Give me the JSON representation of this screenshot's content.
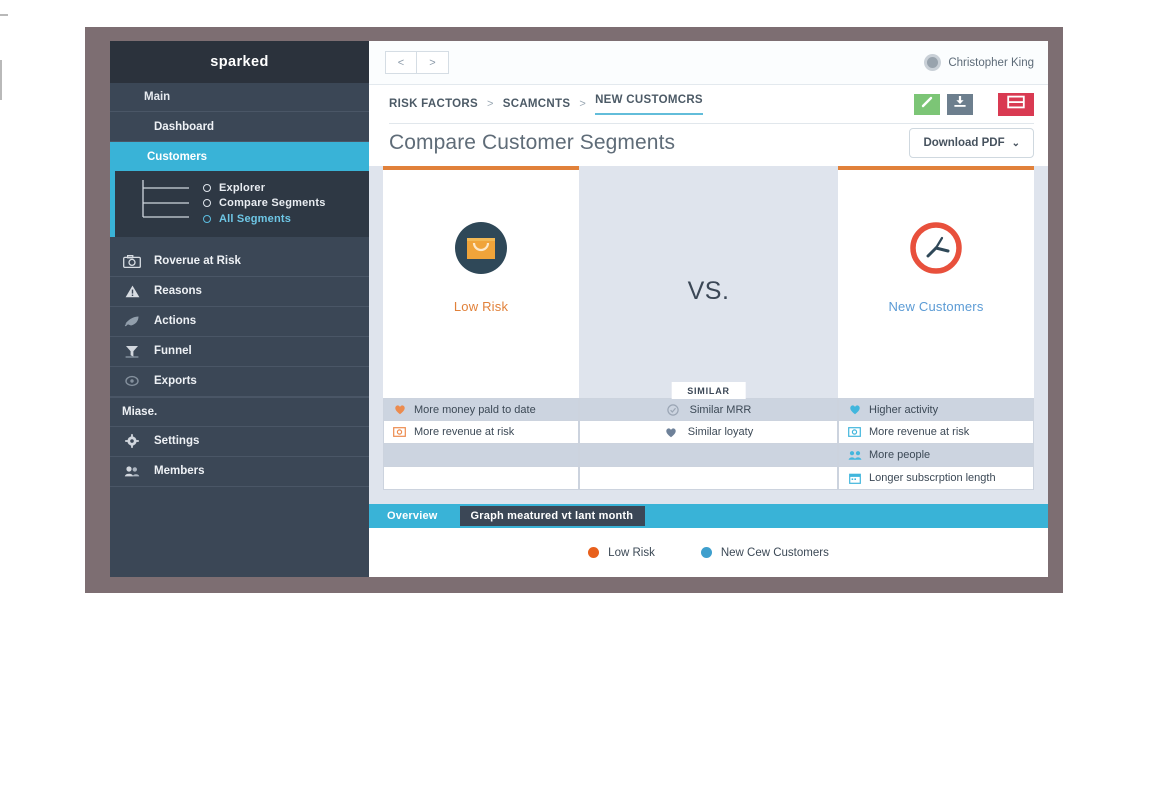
{
  "sidebar": {
    "brand": "sparked",
    "section_main": "Main",
    "items": [
      {
        "label": "Dashboard",
        "icon": "none"
      },
      {
        "label": "Customers",
        "icon": "none"
      }
    ],
    "submenu": [
      {
        "label": "Explorer",
        "selected": false
      },
      {
        "label": "Compare Segments",
        "selected": false
      },
      {
        "label": "All Segments",
        "selected": true
      }
    ],
    "tools": [
      {
        "label": "Roverue at Risk",
        "icon": "camera-icon"
      },
      {
        "label": "Reasons",
        "icon": "warning-triangle-icon"
      },
      {
        "label": "Actions",
        "icon": "rocket-icon"
      },
      {
        "label": "Funnel",
        "icon": "funnel-icon"
      },
      {
        "label": "Exports",
        "icon": "export-icon"
      }
    ],
    "section_misc": "Miase.",
    "bottom": [
      {
        "label": "Settings",
        "icon": "gear-icon"
      },
      {
        "label": "Members",
        "icon": "members-icon"
      }
    ]
  },
  "topbar": {
    "back_label": "<",
    "forward_label": ">",
    "user_name": "Christopher King"
  },
  "breadcrumb": {
    "items": [
      "RISK FACTORS",
      "SCAMCNTS",
      "NEW  CUSTOMCRS"
    ],
    "separator": ">"
  },
  "actions": [
    {
      "name": "edit-button",
      "icon": "pencil-icon",
      "color": "#7cc576"
    },
    {
      "name": "download-button",
      "icon": "download-icon",
      "color": "#6d7f8e"
    },
    {
      "name": "layout-button",
      "icon": "layout-icon",
      "color": "#d93a52"
    }
  ],
  "page": {
    "title": "Compare Customer Segments",
    "download_label": "Download PDF",
    "download_chevron": "⌄"
  },
  "compare": {
    "left": {
      "label": "Low Risk",
      "icon": "shopping-bag-icon",
      "accent": "#e1813a"
    },
    "right": {
      "label": "New Customers",
      "icon": "clock-prohibited-icon",
      "accent": "#5b9bd5"
    },
    "vs_label": "VS.",
    "similar_label": "SIMILAR",
    "left_features": [
      {
        "label": "More money pald to date",
        "icon": "heart-icon"
      },
      {
        "label": "More revenue at risk",
        "icon": "money-icon"
      }
    ],
    "mid_features": [
      {
        "label": "Similar MRR",
        "icon": "circle-check-icon"
      },
      {
        "label": "Similar loyaty",
        "icon": "heart-icon"
      }
    ],
    "right_features": [
      {
        "label": "Higher activity",
        "icon": "heart-icon"
      },
      {
        "label": "More revenue at risk",
        "icon": "money-icon"
      },
      {
        "label": "More  people",
        "icon": "people-icon"
      },
      {
        "label": "Longer subscrption length",
        "icon": "calendar-icon"
      }
    ]
  },
  "bottom": {
    "tab_overview": "Overview",
    "tab_graph": "Graph meatured vt lant month",
    "legend": [
      {
        "label": "Low Risk",
        "color": "#e8601c"
      },
      {
        "label": "New Cew Customers",
        "color": "#3e9fcd"
      }
    ]
  }
}
